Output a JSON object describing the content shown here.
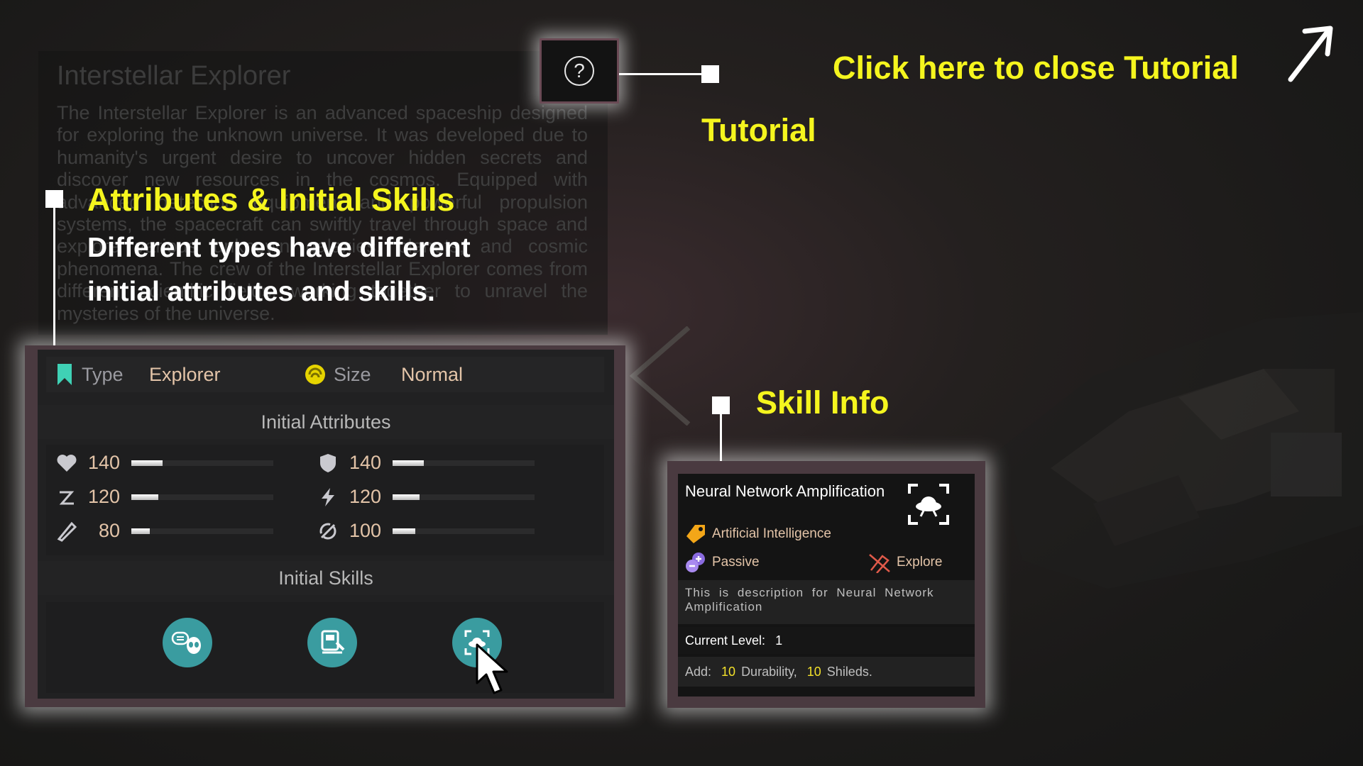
{
  "background_panel": {
    "title": "Interstellar Explorer",
    "description": "The Interstellar Explorer is an advanced spaceship designed for exploring the unknown universe. It was developed due to humanity's urgent desire to uncover hidden secrets and discover new resources in the cosmos. Equipped with advanced detection equipment and powerful propulsion systems, the spacecraft can swiftly travel through space and explore various unknown galaxies, planets, and cosmic phenomena. The crew of the Interstellar Explorer comes from different scientific fields, working together to unravel the mysteries of the universe."
  },
  "tutorial": {
    "label": "Tutorial",
    "close_hint": "Click here to close Tutorial",
    "help_glyph": "?"
  },
  "callouts": {
    "attributes_title": "Attributes & Initial Skills",
    "attributes_desc_line1": "Different types have different",
    "attributes_desc_line2": "initial attributes and skills.",
    "skill_info_title": "Skill Info"
  },
  "attributes_panel": {
    "type_label": "Type",
    "type_value": "Explorer",
    "size_label": "Size",
    "size_value": "Normal",
    "initial_attributes_header": "Initial Attributes",
    "initial_skills_header": "Initial Skills",
    "stats": [
      {
        "icon": "heart-icon",
        "value": "140",
        "fill": 0.22
      },
      {
        "icon": "shield-icon",
        "value": "140",
        "fill": 0.22
      },
      {
        "icon": "speed-icon",
        "value": "120",
        "fill": 0.19
      },
      {
        "icon": "lightning-icon",
        "value": "120",
        "fill": 0.19
      },
      {
        "icon": "blade-icon",
        "value": "80",
        "fill": 0.13
      },
      {
        "icon": "recycle-icon",
        "value": "100",
        "fill": 0.16
      }
    ]
  },
  "skill_panel": {
    "name": "Neural Network Amplification",
    "category": "Artificial Intelligence",
    "mode": "Passive",
    "type": "Explore",
    "description": "This is description for Neural Network Amplification",
    "level_label": "Current Level:",
    "level_value": "1",
    "add_label": "Add:",
    "add_value1": "10",
    "add_text1": "Durability,",
    "add_value2": "10",
    "add_text2": "Shileds."
  },
  "colors": {
    "accent_yellow": "#f5f51e",
    "skill_teal": "#3a9ca0",
    "value_peach": "#e3c4a8"
  }
}
